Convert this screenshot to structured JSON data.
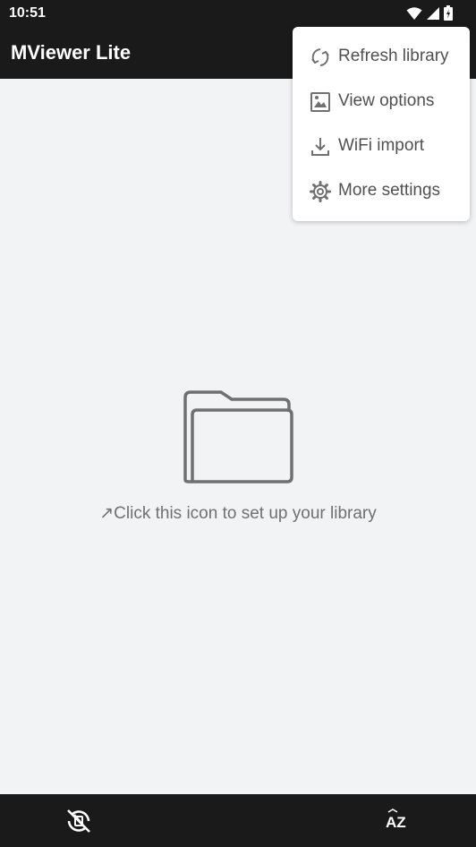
{
  "status_bar": {
    "time": "10:51",
    "icons": [
      "wifi-icon",
      "signal-icon",
      "battery-icon"
    ]
  },
  "app_bar": {
    "title": "MViewer Lite"
  },
  "empty_state": {
    "hint_arrow": "↗",
    "hint_text": "Click this icon to set up your library"
  },
  "menu": {
    "items": [
      {
        "label": "Refresh library",
        "icon": "refresh-icon"
      },
      {
        "label": "View options",
        "icon": "image-icon"
      },
      {
        "label": "WiFi import",
        "icon": "download-icon"
      },
      {
        "label": "More settings",
        "icon": "gear-icon"
      }
    ]
  },
  "bottom_bar": {
    "left_icon": "rotation-lock-off-icon",
    "right_icon": "sort-az-icon",
    "right_text": "AZ"
  },
  "colors": {
    "bar": "#1a1a1a",
    "background": "#f2f3f5",
    "menu_text": "#505050",
    "hint_text": "#707070"
  }
}
